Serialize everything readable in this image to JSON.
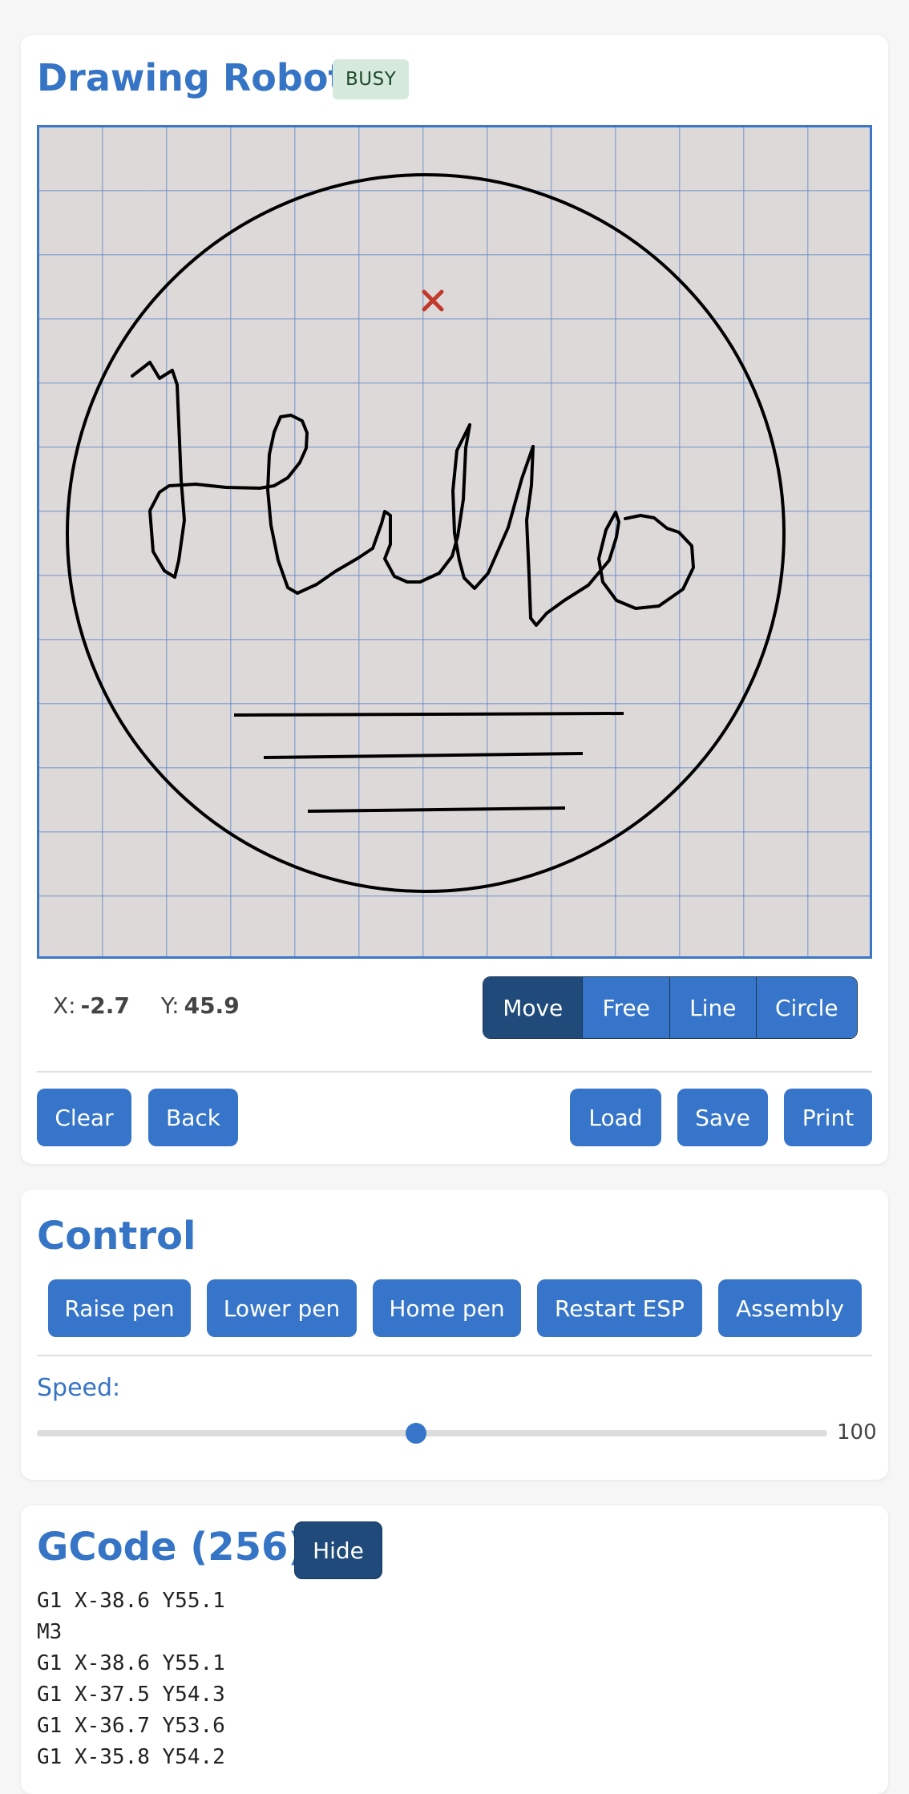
{
  "header": {
    "title": "Drawing Robot",
    "status_badge": "BUSY"
  },
  "canvas": {
    "marker_icon": "x-marker-icon",
    "marker_color": "#c0392b"
  },
  "coords": {
    "x_label": "X:",
    "x_value": "-2.7",
    "y_label": "Y:",
    "y_value": "45.9"
  },
  "modes": {
    "items": [
      "Move",
      "Free",
      "Line",
      "Circle"
    ],
    "selected": "Move"
  },
  "actions": {
    "clear": "Clear",
    "back": "Back",
    "load": "Load",
    "save": "Save",
    "print": "Print"
  },
  "control": {
    "title": "Control",
    "buttons": [
      "Raise pen",
      "Lower pen",
      "Home pen",
      "Restart ESP",
      "Assembly"
    ],
    "speed_label": "Speed:",
    "speed_value": "100",
    "speed_fraction": 0.48
  },
  "gcode": {
    "title": "GCode (256)",
    "hide_label": "Hide",
    "lines": [
      "G1 X-38.6 Y55.1",
      "M3",
      "G1 X-38.6 Y55.1",
      "G1 X-37.5 Y54.3",
      "G1 X-36.7 Y53.6",
      "G1 X-35.8 Y54.2"
    ]
  },
  "colors": {
    "accent": "#3675c9",
    "accent_dark": "#1f4a7a",
    "heading": "#3674c5",
    "badge_bg": "#d6e9dd"
  }
}
